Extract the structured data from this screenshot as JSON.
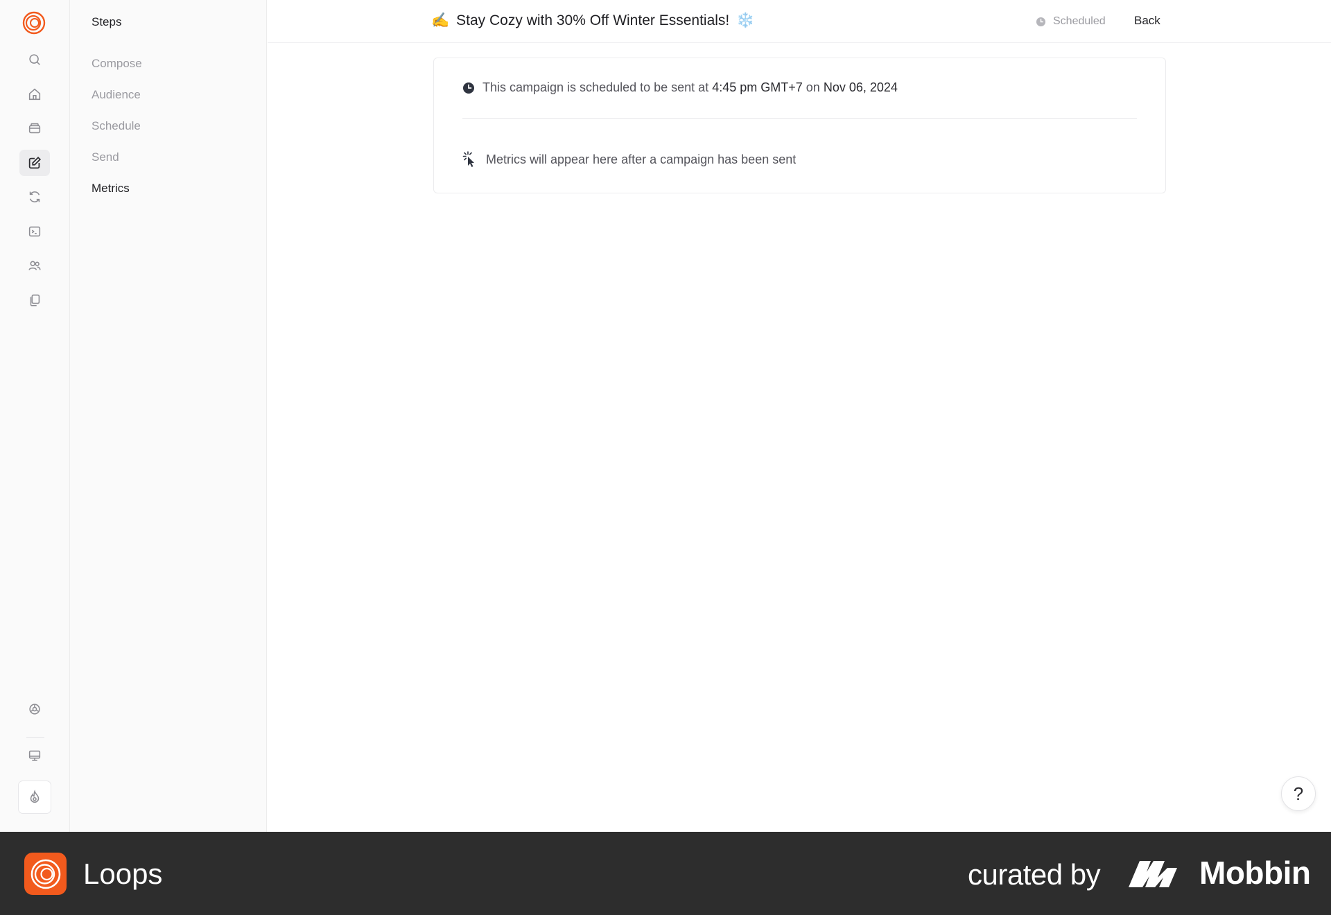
{
  "rail": {
    "items": [
      {
        "name": "search-icon"
      },
      {
        "name": "home-icon"
      },
      {
        "name": "inbox-icon"
      },
      {
        "name": "edit-icon",
        "active": true
      },
      {
        "name": "refresh-icon"
      },
      {
        "name": "terminal-icon"
      },
      {
        "name": "users-icon"
      },
      {
        "name": "copy-icon"
      }
    ],
    "bottom": [
      {
        "name": "settings-icon"
      },
      {
        "name": "monitor-icon"
      },
      {
        "name": "fire-icon"
      }
    ]
  },
  "steps": {
    "heading": "Steps",
    "items": [
      {
        "label": "Compose",
        "active": false
      },
      {
        "label": "Audience",
        "active": false
      },
      {
        "label": "Schedule",
        "active": false
      },
      {
        "label": "Send",
        "active": false
      },
      {
        "label": "Metrics",
        "active": true
      }
    ]
  },
  "header": {
    "title_emoji": "✍️",
    "title": "Stay Cozy with 30% Off Winter Essentials!",
    "title_trailing_emoji": "❄️",
    "status": "Scheduled",
    "back_label": "Back"
  },
  "card": {
    "schedule_prefix": "This campaign is scheduled to be sent at",
    "schedule_time": "4:45 pm GMT+7",
    "schedule_on": "on",
    "schedule_date": "Nov 06, 2024",
    "metrics_note": "Metrics will appear here after a campaign has been sent"
  },
  "help": {
    "label": "?"
  },
  "footer": {
    "brand": "Loops",
    "curated": "curated by",
    "curator": "Mobbin"
  },
  "colors": {
    "accent": "#f25a1d",
    "footer_bg": "#2d2d2d",
    "muted_text": "#9a9aa0"
  }
}
